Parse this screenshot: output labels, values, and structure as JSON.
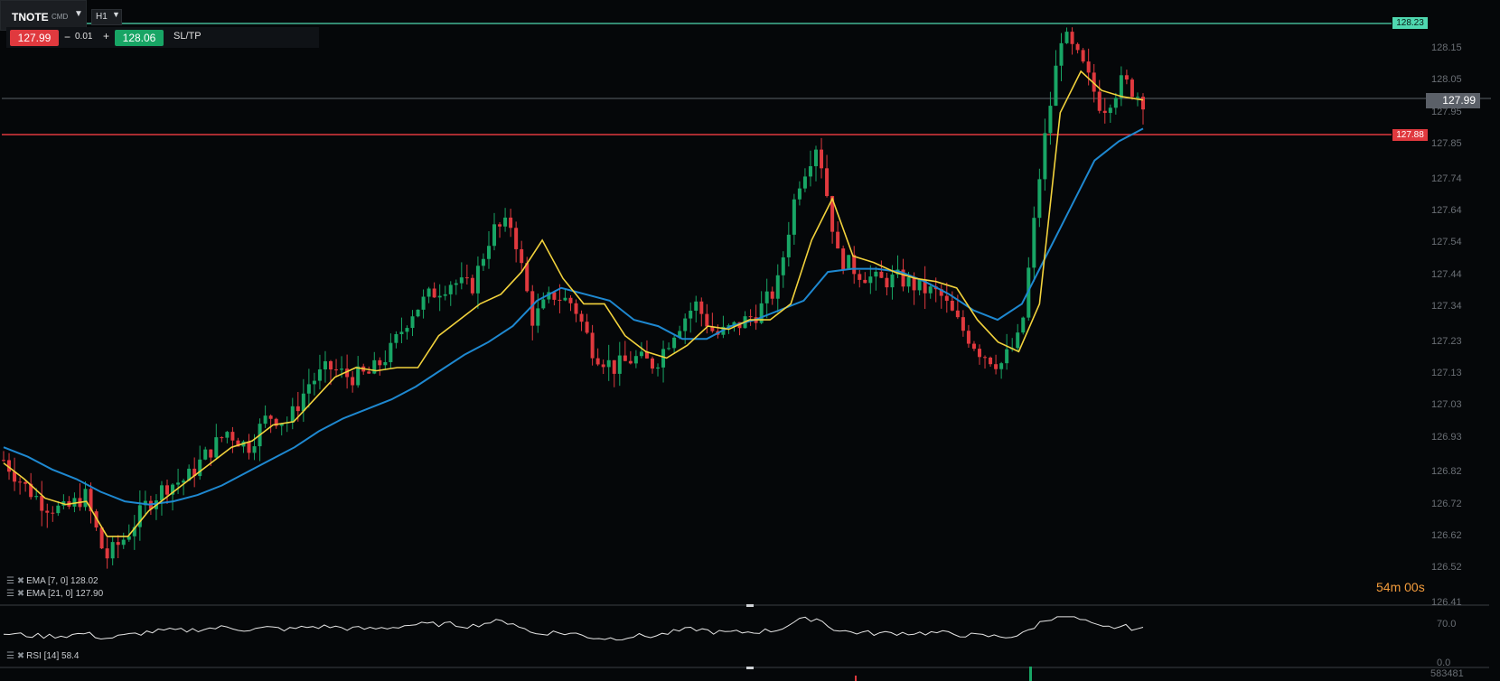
{
  "instrument": {
    "symbol": "TNOTE",
    "type": "CMD",
    "timeframe": "H1"
  },
  "trade_bar": {
    "sell_price": "127.99",
    "minus": "−",
    "quantity": "0.01",
    "plus": "+",
    "buy_price": "128.06",
    "sltp_label": "SL/TP"
  },
  "tools": [
    "line-chart-icon",
    "candle-type-icon",
    "zoom-out-icon",
    "zoom-in-icon",
    "crosshair-icon"
  ],
  "levels": {
    "resistance": {
      "label": "128.23",
      "color": "#4fd8b0"
    },
    "support": {
      "label": "127.88",
      "color": "#e0393e"
    },
    "current": {
      "label": "127.99",
      "color": "#5b6068"
    }
  },
  "countdown": "54m 00s",
  "indicators": {
    "ema7": "EMA [7, 0] 128.02",
    "ema21": "EMA [21, 0] 127.90",
    "rsi": "RSI [14] 58.4",
    "rsi_level_high": "70.0",
    "rsi_level_low": "0.0",
    "volume_value": "583481"
  },
  "chart_data": {
    "type": "line",
    "y_axis_ticks": [
      "128.15",
      "128.05",
      "127.95",
      "127.85",
      "127.74",
      "127.64",
      "127.54",
      "127.44",
      "127.34",
      "127.23",
      "127.13",
      "127.03",
      "126.93",
      "126.82",
      "126.72",
      "126.62",
      "126.52",
      "126.41"
    ],
    "ylim": [
      126.41,
      128.23
    ],
    "series": [
      {
        "name": "EMA [7, 0]",
        "color": "#f2d23c",
        "values": [
          126.85,
          126.8,
          126.74,
          126.72,
          126.73,
          126.62,
          126.62,
          126.7,
          126.75,
          126.8,
          126.85,
          126.9,
          126.92,
          126.97,
          126.98,
          127.05,
          127.12,
          127.15,
          127.14,
          127.15,
          127.15,
          127.25,
          127.3,
          127.35,
          127.38,
          127.45,
          127.55,
          127.43,
          127.35,
          127.35,
          127.25,
          127.2,
          127.18,
          127.22,
          127.28,
          127.27,
          127.3,
          127.3,
          127.35,
          127.55,
          127.68,
          127.5,
          127.48,
          127.45,
          127.43,
          127.42,
          127.4,
          127.3,
          127.23,
          127.2,
          127.35,
          127.95,
          128.08,
          128.02,
          128.0,
          127.99
        ]
      },
      {
        "name": "EMA [21, 0]",
        "color": "#1e88d0",
        "values": [
          126.9,
          126.87,
          126.83,
          126.8,
          126.76,
          126.73,
          126.72,
          126.73,
          126.75,
          126.78,
          126.82,
          126.86,
          126.9,
          126.95,
          126.99,
          127.02,
          127.05,
          127.09,
          127.14,
          127.19,
          127.23,
          127.28,
          127.36,
          127.4,
          127.38,
          127.36,
          127.3,
          127.28,
          127.24,
          127.24,
          127.28,
          127.3,
          127.33,
          127.36,
          127.45,
          127.46,
          127.46,
          127.45,
          127.42,
          127.38,
          127.33,
          127.3,
          127.35,
          127.5,
          127.65,
          127.8,
          127.86,
          127.9
        ]
      },
      {
        "name": "Price",
        "color": "#d0d0d0",
        "values": [
          126.86,
          126.78,
          126.72,
          126.7,
          126.75,
          126.55,
          126.62,
          126.72,
          126.78,
          126.8,
          126.88,
          126.95,
          126.9,
          127.0,
          126.98,
          127.1,
          127.15,
          127.12,
          127.13,
          127.2,
          127.32,
          127.38,
          127.42,
          127.4,
          127.58,
          127.6,
          127.3,
          127.38,
          127.35,
          127.2,
          127.15,
          127.18,
          127.16,
          127.27,
          127.35,
          127.25,
          127.28,
          127.32,
          127.4,
          127.72,
          127.86,
          127.5,
          127.45,
          127.42,
          127.43,
          127.4,
          127.38,
          127.28,
          127.2,
          127.16,
          127.25,
          127.8,
          128.2,
          128.1,
          127.96,
          128.05,
          127.99
        ]
      }
    ]
  }
}
